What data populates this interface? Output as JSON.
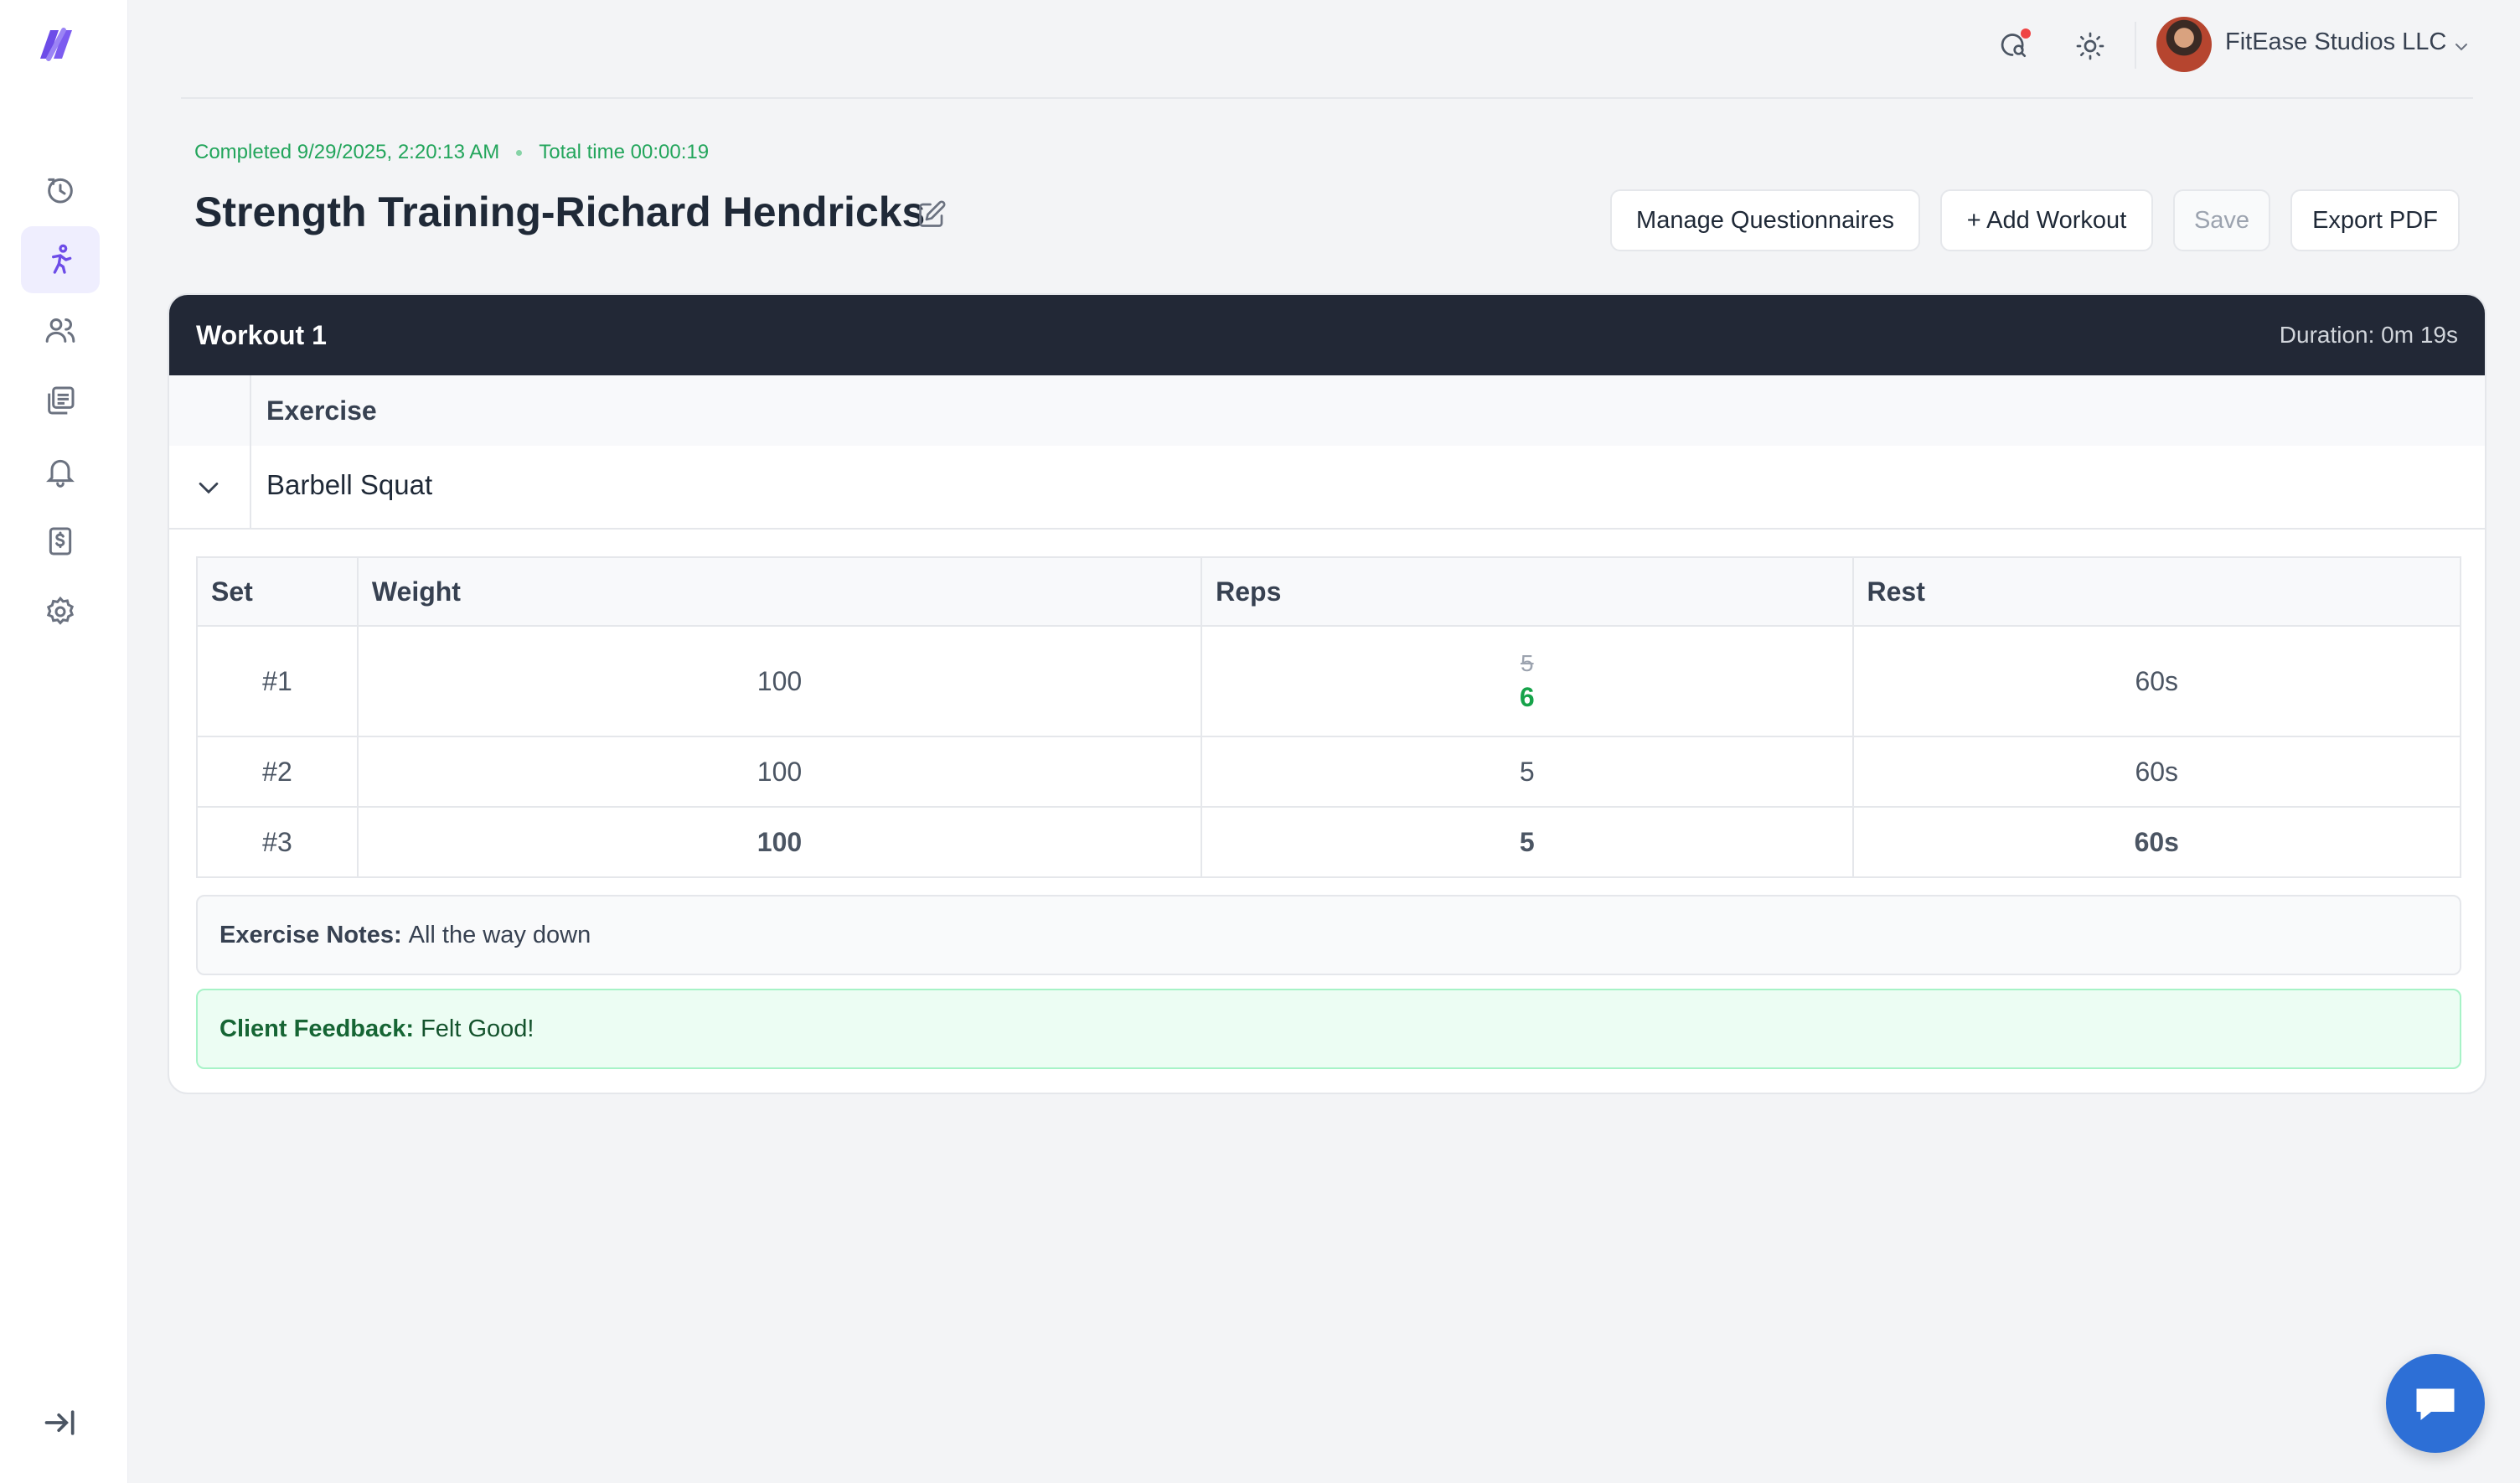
{
  "account": {
    "name": "FitEase Studios LLC"
  },
  "meta": {
    "completed": "Completed 9/29/2025, 2:20:13 AM",
    "total_time_label": "Total time",
    "total_time_value": "00:00:19"
  },
  "page": {
    "title": "Strength Training-Richard Hendricks"
  },
  "actions": {
    "manage_questionnaires": "Manage Questionnaires",
    "add_workout": "+ Add Workout",
    "save": "Save",
    "export_pdf": "Export PDF"
  },
  "workout": {
    "title": "Workout 1",
    "duration": "Duration: 0m 19s",
    "exercise_column": "Exercise",
    "exercise_name": "Barbell Squat",
    "set_headers": [
      "Set",
      "Weight",
      "Reps",
      "Rest"
    ],
    "sets": [
      {
        "set": "#1",
        "weight": "100",
        "reps_original": "5",
        "reps": "6",
        "rest": "60s"
      },
      {
        "set": "#2",
        "weight": "100",
        "reps": "5",
        "rest": "60s"
      },
      {
        "set": "#3",
        "weight": "100",
        "reps": "5",
        "rest": "60s",
        "status": "missed"
      }
    ],
    "notes_label": "Exercise Notes:",
    "notes_text": "All the way down",
    "feedback_label": "Client Feedback:",
    "feedback_text": "Felt Good!"
  },
  "colors": {
    "accent": "#6d4ce8",
    "success": "#16a34a",
    "danger": "#ef4444",
    "header": "#222836",
    "chat": "#2d6fd6"
  },
  "icons": [
    "logo-icon",
    "history-icon",
    "workout-icon",
    "clients-icon",
    "library-icon",
    "bell-icon",
    "billing-icon",
    "settings-icon",
    "search-chat-icon",
    "sun-icon",
    "chevron-down-icon",
    "edit-icon",
    "collapse-sidebar-icon",
    "chat-icon"
  ]
}
